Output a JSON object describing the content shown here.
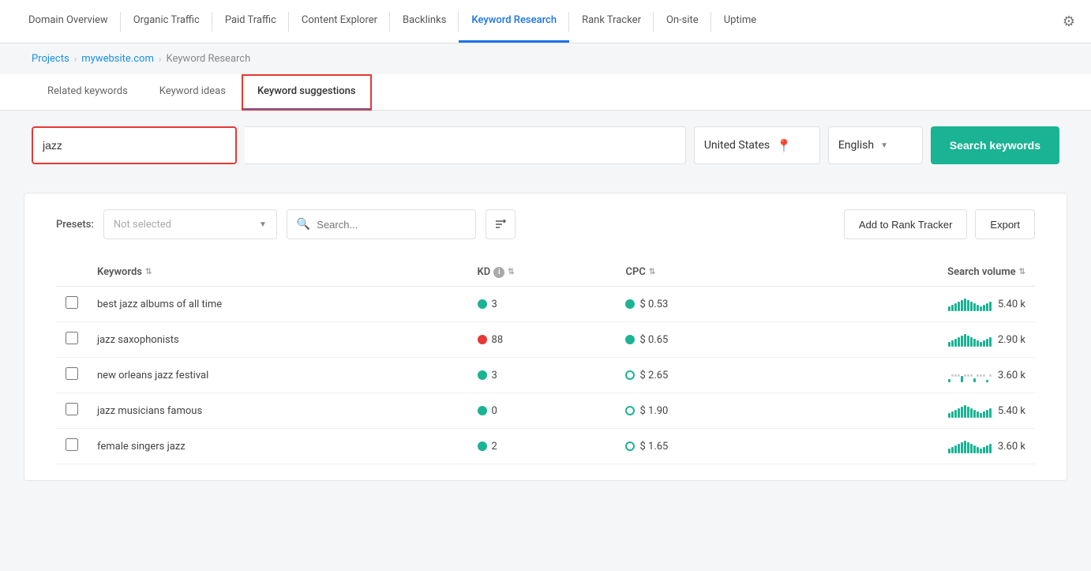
{
  "nav": {
    "items": [
      {
        "id": "domain-overview",
        "label": "Domain Overview",
        "active": false
      },
      {
        "id": "organic-traffic",
        "label": "Organic Traffic",
        "active": false
      },
      {
        "id": "paid-traffic",
        "label": "Paid Traffic",
        "active": false
      },
      {
        "id": "content-explorer",
        "label": "Content Explorer",
        "active": false
      },
      {
        "id": "backlinks",
        "label": "Backlinks",
        "active": false
      },
      {
        "id": "keyword-research",
        "label": "Keyword Research",
        "active": true
      },
      {
        "id": "rank-tracker",
        "label": "Rank Tracker",
        "active": false
      },
      {
        "id": "on-site",
        "label": "On-site",
        "active": false
      },
      {
        "id": "uptime",
        "label": "Uptime",
        "active": false
      }
    ]
  },
  "breadcrumb": {
    "projects": "Projects",
    "site": "mywebsite.com",
    "current": "Keyword Research"
  },
  "tabs": [
    {
      "id": "related-keywords",
      "label": "Related keywords",
      "active": false
    },
    {
      "id": "keyword-ideas",
      "label": "Keyword ideas",
      "active": false
    },
    {
      "id": "keyword-suggestions",
      "label": "Keyword suggestions",
      "active": true
    }
  ],
  "searchBar": {
    "keyword_value": "jazz",
    "keyword_placeholder": "jazz",
    "location": "United States",
    "language": "English",
    "search_btn": "Search keywords"
  },
  "toolbar": {
    "presets_label": "Presets:",
    "presets_placeholder": "Not selected",
    "search_placeholder": "Search...",
    "add_tracker_btn": "Add to Rank Tracker",
    "export_btn": "Export"
  },
  "table": {
    "columns": {
      "keywords": "Keywords",
      "kd": "KD",
      "cpc": "CPC",
      "search_volume": "Search volume"
    },
    "rows": [
      {
        "keyword": "best jazz albums of all time",
        "kd_dot": "green",
        "kd_value": "3",
        "cpc_dot": "green",
        "cpc_value": "$ 0.53",
        "vol_value": "5.40 k",
        "vol_type": "full"
      },
      {
        "keyword": "jazz saxophonists",
        "kd_dot": "red",
        "kd_value": "88",
        "cpc_dot": "green",
        "cpc_value": "$ 0.65",
        "vol_value": "2.90 k",
        "vol_type": "full"
      },
      {
        "keyword": "new orleans jazz festival",
        "kd_dot": "green",
        "kd_value": "3",
        "cpc_dot": "yellow",
        "cpc_value": "$ 2.65",
        "vol_value": "3.60 k",
        "vol_type": "sparse"
      },
      {
        "keyword": "jazz musicians famous",
        "kd_dot": "green",
        "kd_value": "0",
        "cpc_dot": "yellow",
        "cpc_value": "$ 1.90",
        "vol_value": "5.40 k",
        "vol_type": "full"
      },
      {
        "keyword": "female singers jazz",
        "kd_dot": "green",
        "kd_value": "2",
        "cpc_dot": "yellow",
        "cpc_value": "$ 1.65",
        "vol_value": "3.60 k",
        "vol_type": "full"
      }
    ]
  }
}
